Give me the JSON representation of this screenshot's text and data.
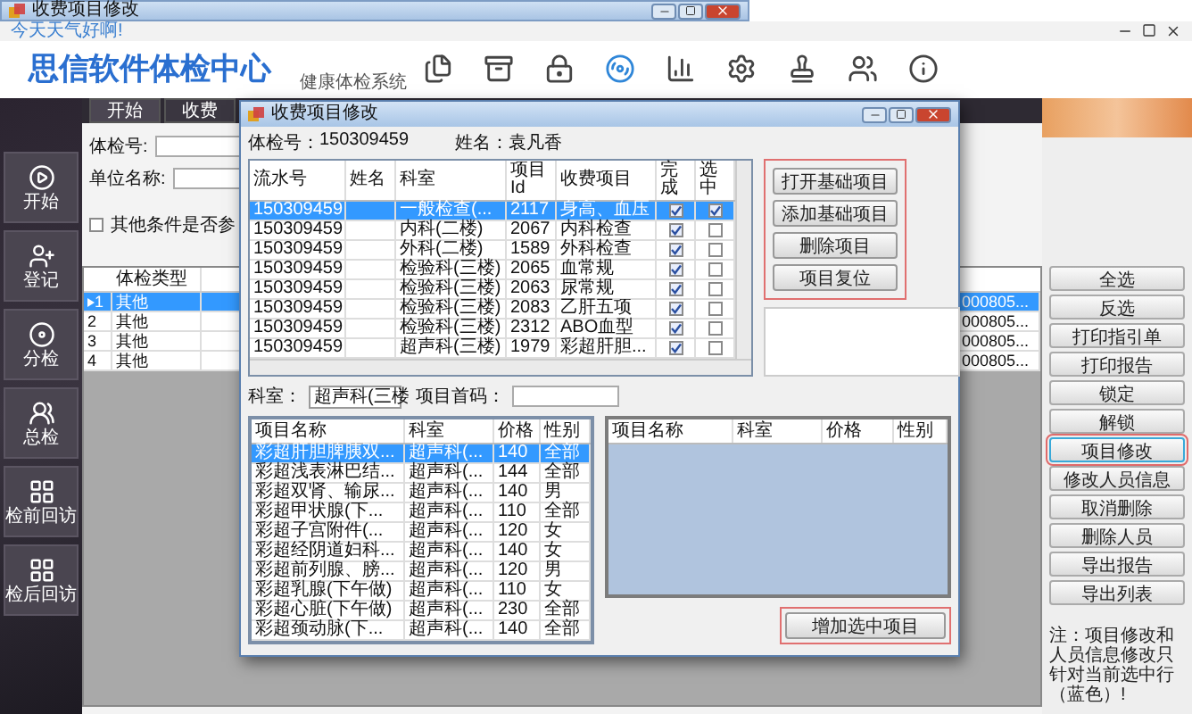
{
  "back_window": {
    "title": "收费项目修改"
  },
  "greeting": "今天天气好啊!",
  "header": {
    "title": "思信软件体检中心",
    "subtitle": "健康体检系统",
    "toolbar": [
      {
        "kind": "files",
        "selected": false
      },
      {
        "kind": "archive",
        "selected": false
      },
      {
        "kind": "lock",
        "selected": false
      },
      {
        "kind": "disc",
        "selected": true
      },
      {
        "kind": "chart",
        "selected": false
      },
      {
        "kind": "settings",
        "selected": false
      },
      {
        "kind": "stamp",
        "selected": false
      },
      {
        "kind": "users",
        "selected": false
      },
      {
        "kind": "info",
        "selected": false
      }
    ]
  },
  "sidebar": [
    {
      "kind": "play",
      "label": "开始"
    },
    {
      "kind": "register",
      "label": "登记"
    },
    {
      "kind": "disc",
      "label": "分检"
    },
    {
      "kind": "people",
      "label": "总检"
    },
    {
      "kind": "grid",
      "label": "检前回访"
    },
    {
      "kind": "grid",
      "label": "检后回访"
    }
  ],
  "tabs": [
    {
      "label": "开始",
      "selected": true
    },
    {
      "label": "收费",
      "selected": false
    }
  ],
  "search_form": {
    "exam_no_label": "体检号:",
    "company_label": "单位名称:",
    "other_conditions": {
      "label": "其他条件是否参",
      "checked": false
    }
  },
  "patients": {
    "columns": [
      "体检类型"
    ],
    "rows": [
      {
        "index": "1",
        "type": "其他",
        "code": "000805...",
        "selected": true
      },
      {
        "index": "2",
        "type": "其他",
        "code": "000805...",
        "selected": false
      },
      {
        "index": "3",
        "type": "其他",
        "code": "000805...",
        "selected": false
      },
      {
        "index": "4",
        "type": "其他",
        "code": "000805...",
        "selected": false
      }
    ]
  },
  "actions": [
    {
      "label": "全选",
      "highlighted": false
    },
    {
      "label": "反选",
      "highlighted": false
    },
    {
      "label": "打印指引单",
      "highlighted": false
    },
    {
      "label": "打印报告",
      "highlighted": false
    },
    {
      "label": "锁定",
      "highlighted": false
    },
    {
      "label": "解锁",
      "highlighted": false
    },
    {
      "label": "项目修改",
      "highlighted": true
    },
    {
      "label": "修改人员信息",
      "highlighted": false
    },
    {
      "label": "取消删除",
      "highlighted": false
    },
    {
      "label": "删除人员",
      "highlighted": false
    },
    {
      "label": "导出报告",
      "highlighted": false
    },
    {
      "label": "导出列表",
      "highlighted": false
    }
  ],
  "note": "注：项目修改和人员信息修改只针对当前选中行（蓝色）!",
  "dialog": {
    "title": "收费项目修改",
    "exam_no_label": "体检号：",
    "exam_no": "150309459",
    "name_label": "姓名：",
    "name": "袁凡香",
    "items": {
      "columns": [
        "流水号",
        "姓名",
        "科室",
        "项目Id",
        "收费项目",
        "完成",
        "选中"
      ],
      "rows": [
        {
          "serial": "150309459",
          "dept": "一般检查(...",
          "id": "2117",
          "item": "身高、血压",
          "completed": true,
          "checked": true,
          "selected": true
        },
        {
          "serial": "150309459",
          "dept": "内科(二楼)",
          "id": "2067",
          "item": "内科检查",
          "completed": true,
          "checked": false,
          "selected": false
        },
        {
          "serial": "150309459",
          "dept": "外科(二楼)",
          "id": "1589",
          "item": "外科检查",
          "completed": true,
          "checked": false,
          "selected": false
        },
        {
          "serial": "150309459",
          "dept": "检验科(三楼)",
          "id": "2065",
          "item": "血常规",
          "completed": true,
          "checked": false,
          "selected": false
        },
        {
          "serial": "150309459",
          "dept": "检验科(三楼)",
          "id": "2063",
          "item": "尿常规",
          "completed": true,
          "checked": false,
          "selected": false
        },
        {
          "serial": "150309459",
          "dept": "检验科(三楼)",
          "id": "2083",
          "item": "乙肝五项",
          "completed": true,
          "checked": false,
          "selected": false
        },
        {
          "serial": "150309459",
          "dept": "检验科(三楼)",
          "id": "2312",
          "item": "ABO血型",
          "completed": true,
          "checked": false,
          "selected": false
        },
        {
          "serial": "150309459",
          "dept": "超声科(三楼)",
          "id": "1979",
          "item": "彩超肝胆...",
          "completed": true,
          "checked": false,
          "selected": false
        }
      ]
    },
    "item_buttons": {
      "highlighted": true,
      "buttons": [
        "打开基础项目",
        "添加基础项目",
        "删除项目",
        "项目复位"
      ]
    },
    "dept_label": "科室：",
    "dept_value": "超声科(三楼",
    "code_label": "项目首码：",
    "catalog": {
      "columns": [
        "项目名称",
        "科室",
        "价格",
        "性别"
      ],
      "rows": [
        {
          "name": "彩超肝胆脾胰双...",
          "dept": "超声科(...",
          "price": "140",
          "sex": "全部",
          "selected": true
        },
        {
          "name": "彩超浅表淋巴结...",
          "dept": "超声科(...",
          "price": "144",
          "sex": "全部",
          "selected": false
        },
        {
          "name": "彩超双肾、输尿...",
          "dept": "超声科(...",
          "price": "140",
          "sex": "男",
          "selected": false
        },
        {
          "name": "彩超甲状腺(下...",
          "dept": "超声科(...",
          "price": "110",
          "sex": "全部",
          "selected": false
        },
        {
          "name": "彩超子宫附件(...",
          "dept": "超声科(...",
          "price": "120",
          "sex": "女",
          "selected": false
        },
        {
          "name": "彩超经阴道妇科...",
          "dept": "超声科(...",
          "price": "140",
          "sex": "女",
          "selected": false
        },
        {
          "name": "彩超前列腺、膀...",
          "dept": "超声科(...",
          "price": "120",
          "sex": "男",
          "selected": false
        },
        {
          "name": "彩超乳腺(下午做)",
          "dept": "超声科(...",
          "price": "110",
          "sex": "女",
          "selected": false
        },
        {
          "name": "彩超心脏(下午做)",
          "dept": "超声科(...",
          "price": "230",
          "sex": "全部",
          "selected": false
        },
        {
          "name": "彩超颈动脉(下...",
          "dept": "超声科(...",
          "price": "140",
          "sex": "全部",
          "selected": false
        }
      ]
    },
    "chosen": {
      "columns": [
        "项目名称",
        "科室",
        "价格",
        "性别"
      ]
    },
    "add_button": {
      "label": "增加选中项目",
      "highlighted": true
    }
  }
}
